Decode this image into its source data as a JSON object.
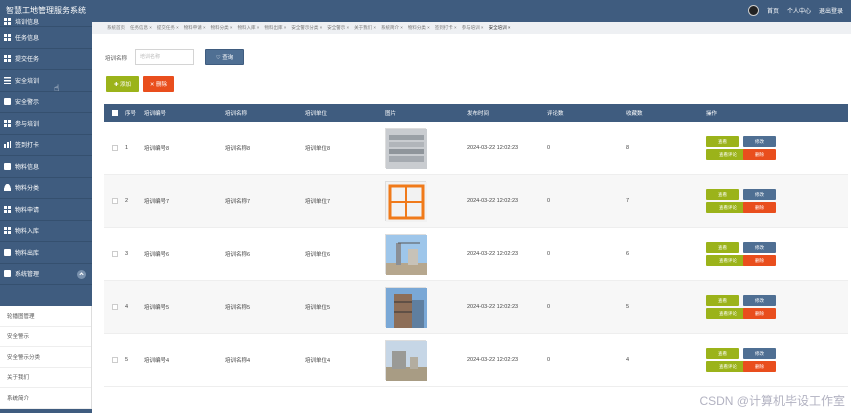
{
  "app": {
    "title": "智慧工地管理服务系统"
  },
  "topbar": {
    "home": "首页",
    "profile": "个人中心",
    "logout": "退出登录"
  },
  "sidebar": {
    "items": [
      {
        "label": "培训信息",
        "icon": "grid-icon"
      },
      {
        "label": "任务信息",
        "icon": "grid-icon"
      },
      {
        "label": "提交任务",
        "icon": "grid-icon"
      },
      {
        "label": "安全培训",
        "icon": "list-icon"
      },
      {
        "label": "安全警示",
        "icon": "plane-icon"
      },
      {
        "label": "参与培训",
        "icon": "grid-icon"
      },
      {
        "label": "签到打卡",
        "icon": "bar-chart-icon"
      },
      {
        "label": "物料信息",
        "icon": "clipboard-icon"
      },
      {
        "label": "物料分类",
        "icon": "person-icon"
      },
      {
        "label": "物料申请",
        "icon": "grid-icon"
      },
      {
        "label": "物料入库",
        "icon": "grid-icon"
      },
      {
        "label": "物料出库",
        "icon": "clipboard-icon"
      },
      {
        "label": "系统管理",
        "icon": "chat-icon"
      }
    ],
    "submenu": [
      "轮播图管理",
      "安全警示",
      "安全警示分类",
      "关于我们",
      "系统简介"
    ]
  },
  "tabs": [
    "系统首页",
    "任务信息 ×",
    "提交任务 ×",
    "物料申请 ×",
    "物料分类 ×",
    "物料入库 ×",
    "物料出库 ×",
    "安全警示分类 ×",
    "安全警示 ×",
    "关于我们 ×",
    "系统简介 ×",
    "物料分类 ×",
    "签到打卡 ×",
    "参与培训 ×",
    "安全培训 ×"
  ],
  "search": {
    "label": "培训名称",
    "placeholder": "培训名称",
    "button": "♡ 查询"
  },
  "actions": {
    "add": "✚ 添加",
    "delete": "✕ 删除"
  },
  "table": {
    "headers": [
      "序号",
      "培训编号",
      "培训名称",
      "培训单位",
      "图片",
      "发布时间",
      "评论数",
      "收藏数",
      "操作"
    ],
    "op_labels": {
      "view": "查看",
      "edit": "修改",
      "comments": "查看评论",
      "delete": "删除"
    },
    "rows": [
      {
        "no": "1",
        "code": "培训编号8",
        "name": "培训名称8",
        "unit": "培训单位8",
        "time": "2024-03-22 12:02:23",
        "comments": "0",
        "fav": "8"
      },
      {
        "no": "2",
        "code": "培训编号7",
        "name": "培训名称7",
        "unit": "培训单位7",
        "time": "2024-03-22 12:02:23",
        "comments": "0",
        "fav": "7"
      },
      {
        "no": "3",
        "code": "培训编号6",
        "name": "培训名称6",
        "unit": "培训单位6",
        "time": "2024-03-22 12:02:23",
        "comments": "0",
        "fav": "6"
      },
      {
        "no": "4",
        "code": "培训编号5",
        "name": "培训名称5",
        "unit": "培训单位5",
        "time": "2024-03-22 12:02:23",
        "comments": "0",
        "fav": "5"
      },
      {
        "no": "5",
        "code": "培训编号4",
        "name": "培训名称4",
        "unit": "培训单位4",
        "time": "2024-03-22 12:02:23",
        "comments": "0",
        "fav": "4"
      }
    ]
  },
  "watermark": "CSDN @计算机毕设工作室",
  "colors": {
    "primary": "#3f5c7f",
    "green": "#9bb31a",
    "red": "#e94e1d",
    "blue": "#4f6f93"
  }
}
